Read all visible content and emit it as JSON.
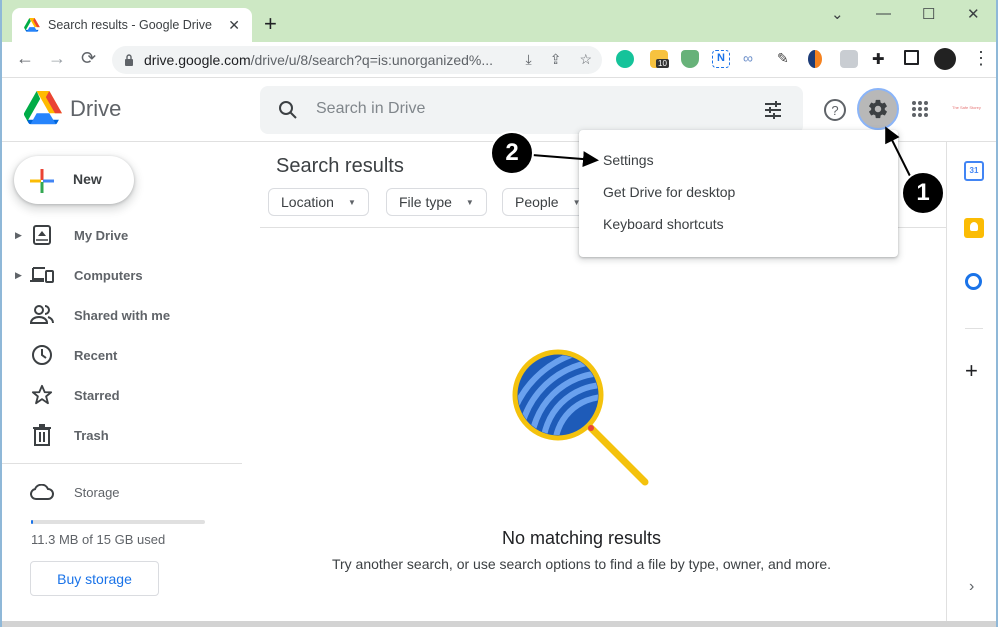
{
  "browser": {
    "tab_title": "Search results - Google Drive",
    "tab_close": "✕",
    "new_tab": "+",
    "window_controls": {
      "tab_search": "⌄",
      "minimize": "—",
      "maximize": "☐",
      "close": "✕"
    },
    "url_host": "drive.google.com",
    "url_path": "/drive/u/8/search?q=is:unorganized%...",
    "extensions_badge": "10",
    "icons": [
      "back-icon",
      "forward-icon",
      "reload-icon",
      "lock-icon",
      "install-icon",
      "share-icon",
      "star-icon",
      "grammarly-icon",
      "extension-10-icon",
      "adguard-icon",
      "notion-icon",
      "link-icon",
      "eyedropper-icon",
      "sync-icon",
      "extension-gray-icon",
      "puzzle-icon",
      "sidepanel-icon",
      "profile-avatar",
      "menu-icon"
    ]
  },
  "header": {
    "logo_text": "Drive",
    "search_placeholder": "Search in Drive",
    "brand_text": "The Safe Storey",
    "icons": [
      "search-icon",
      "search-options-icon",
      "help-icon",
      "settings-gear-icon",
      "apps-grid-icon"
    ]
  },
  "sidebar": {
    "new_label": "New",
    "items": [
      {
        "label": "My Drive",
        "icon": "my-drive-icon",
        "expandable": true
      },
      {
        "label": "Computers",
        "icon": "computers-icon",
        "expandable": true
      },
      {
        "label": "Shared with me",
        "icon": "shared-icon",
        "expandable": false
      },
      {
        "label": "Recent",
        "icon": "clock-icon",
        "expandable": false
      },
      {
        "label": "Starred",
        "icon": "star-icon",
        "expandable": false
      },
      {
        "label": "Trash",
        "icon": "trash-icon",
        "expandable": false
      }
    ],
    "storage": {
      "label": "Storage",
      "used_text": "11.3 MB of 15 GB used",
      "used_fraction": 0.0007,
      "buy_label": "Buy storage"
    }
  },
  "main": {
    "title": "Search results",
    "filters": [
      "Location",
      "File type",
      "People"
    ],
    "empty_title": "No matching results",
    "empty_subtitle": "Try another search, or use search options to find a file by type, owner, and more."
  },
  "settings_menu": {
    "items": [
      "Settings",
      "Get Drive for desktop",
      "Keyboard shortcuts"
    ]
  },
  "side_panel": {
    "apps": [
      "calendar-icon",
      "keep-icon",
      "tasks-icon"
    ],
    "add_label": "+",
    "collapse_label": "›",
    "calendar_day": "31"
  },
  "annotations": {
    "step1": "1",
    "step2": "2"
  },
  "colors": {
    "tabbar_bg": "#cde8c4",
    "accent_blue": "#1a73e8",
    "gear_highlight": "#b8b8b8"
  }
}
